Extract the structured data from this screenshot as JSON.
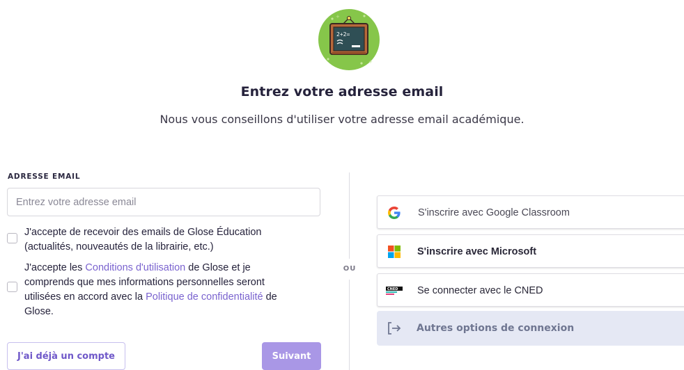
{
  "header": {
    "title": "Entrez votre adresse email",
    "subtitle": "Nous vous conseillons d'utiliser votre adresse email académique.",
    "logo_icon": "chalkboard-icon",
    "logo_text": "2+2="
  },
  "form": {
    "email_label": "ADRESSE EMAIL",
    "email_placeholder": "Entrez votre adresse email",
    "email_value": "",
    "newsletter_checked": false,
    "newsletter_text": "J'accepte de recevoir des emails de Glose Éducation (actualités, nouveautés de la librairie, etc.)",
    "terms_checked": false,
    "terms_part1": "J'accepte les ",
    "terms_link1": "Conditions d'utilisation",
    "terms_part2": " de Glose et je comprends que mes informations personnelles seront utilisées en accord avec la ",
    "terms_link2": "Politique de confidentialité",
    "terms_part3": " de Glose.",
    "account_button": "J'ai déjà un compte",
    "next_button": "Suivant"
  },
  "separator": {
    "label": "OU"
  },
  "social": {
    "google": {
      "label": "S'inscrire avec Google Classroom",
      "icon": "google-icon"
    },
    "microsoft": {
      "label": "S'inscrire avec Microsoft",
      "icon": "microsoft-icon"
    },
    "cned": {
      "label": "Se connecter avec le CNED",
      "icon": "cned-icon",
      "logo_text": "CNED"
    },
    "other": {
      "label": "Autres options de connexion",
      "icon": "sign-in-icon"
    }
  },
  "colors": {
    "accent": "#7a63cf",
    "primary_button": "#a997e6",
    "other_bg": "#e5e8f4",
    "logo_green": "#86c64a"
  }
}
